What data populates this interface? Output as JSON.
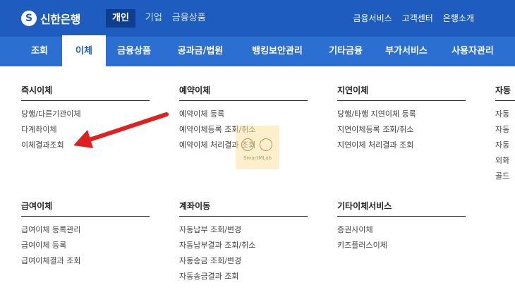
{
  "header": {
    "logo_mark": "S",
    "logo_text": "신한은행",
    "tabs": [
      {
        "label": "개인",
        "active": true
      },
      {
        "label": "기업",
        "active": false
      },
      {
        "label": "금융상품",
        "active": false
      }
    ],
    "util_links": [
      "금융서비스",
      "고객센터",
      "은행소개"
    ]
  },
  "gnb": {
    "items": [
      {
        "label": "조회",
        "active": false
      },
      {
        "label": "이체",
        "active": true
      },
      {
        "label": "금융상품",
        "active": false
      },
      {
        "label": "공과금/법원",
        "active": false
      },
      {
        "label": "뱅킹보안관리",
        "active": false
      },
      {
        "label": "기타금융",
        "active": false
      },
      {
        "label": "부가서비스",
        "active": false
      },
      {
        "label": "사용자관리",
        "active": false
      }
    ]
  },
  "mega_menu": {
    "groups": [
      {
        "title": "즉시이체",
        "items": [
          "당행/다른기관이체",
          "다계좌이체",
          "이체결과조회"
        ]
      },
      {
        "title": "예약이체",
        "items": [
          "예약이체 등록",
          "예약이체등록 조회/취소",
          "예약이체 처리결과 조회"
        ]
      },
      {
        "title": "지연이체",
        "items": [
          "당행/타행 지연이체 등록",
          "지연이체등록 조회/취소",
          "지연이체 처리결과 조회"
        ]
      },
      {
        "title": "자동",
        "items": [
          "자동",
          "자동",
          "자동",
          "외화",
          "골드"
        ]
      },
      {
        "title": "급여이체",
        "items": [
          "급여이체 등록관리",
          "급여이체 등록",
          "급여이체결과 조회"
        ]
      },
      {
        "title": "계좌이동",
        "items": [
          "자동납부 조회/변경",
          "자동납부결과 조회/취소",
          "자동송금 조회/변경",
          "자동송금결과 조회"
        ]
      },
      {
        "title": "기타이체서비스",
        "items": [
          "증권사이체",
          "키즈플러스이체"
        ]
      }
    ]
  },
  "watermark": {
    "text": "SmartMLab"
  },
  "colors": {
    "topbar": "#1f5cbf",
    "gnb": "#2a6fd1",
    "active_tab": "#0e3f8f",
    "annotation_arrow": "#e02020"
  }
}
